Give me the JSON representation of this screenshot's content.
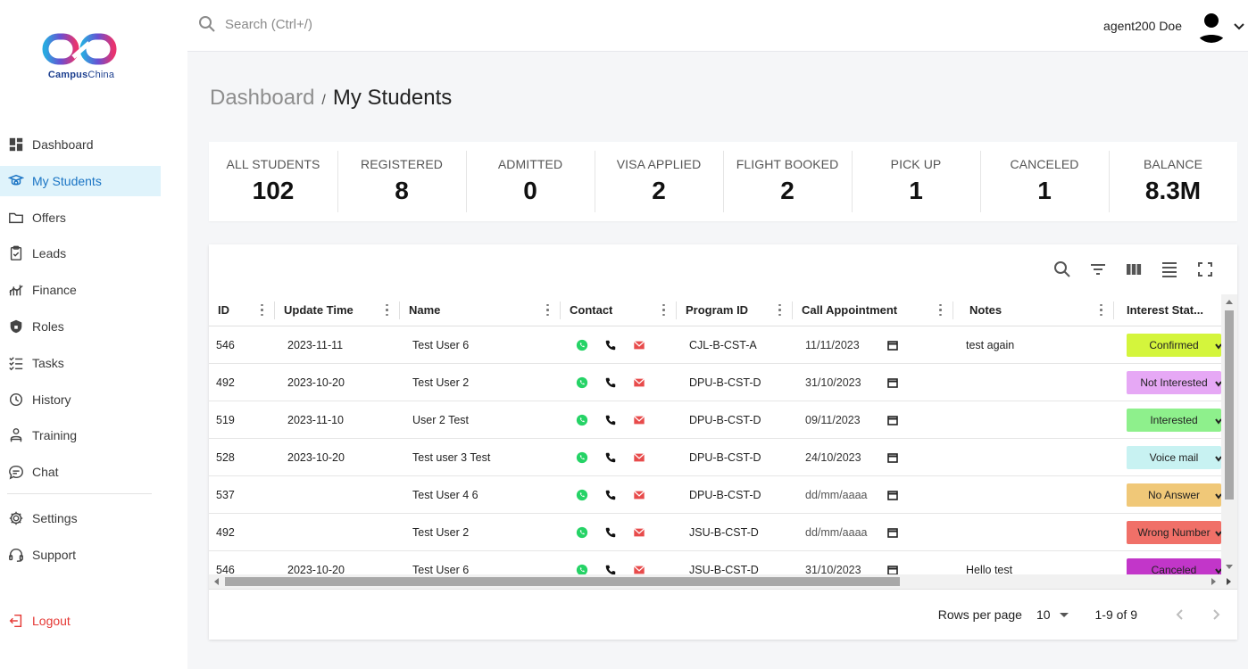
{
  "brand": {
    "name_bold": "Campus",
    "name_light": "China"
  },
  "sidebar": {
    "items": [
      {
        "label": "Dashboard",
        "icon": "dashboard-icon",
        "active": false
      },
      {
        "label": "My Students",
        "icon": "student-icon",
        "active": true
      },
      {
        "label": "Offers",
        "icon": "folder-icon",
        "active": false
      },
      {
        "label": "Leads",
        "icon": "clipboard-icon",
        "active": false
      },
      {
        "label": "Finance",
        "icon": "chart-icon",
        "active": false
      },
      {
        "label": "Roles",
        "icon": "shield-icon",
        "active": false
      },
      {
        "label": "Tasks",
        "icon": "checklist-icon",
        "active": false
      },
      {
        "label": "History",
        "icon": "history-icon",
        "active": false
      },
      {
        "label": "Training",
        "icon": "training-icon",
        "active": false
      },
      {
        "label": "Chat",
        "icon": "chat-icon",
        "active": false
      }
    ],
    "bottom_items": [
      {
        "label": "Settings",
        "icon": "gear-icon"
      },
      {
        "label": "Support",
        "icon": "headset-icon"
      }
    ],
    "logout_label": "Logout"
  },
  "topbar": {
    "search_placeholder": "Search (Ctrl+/)",
    "user_name": "agent200 Doe"
  },
  "breadcrumb": {
    "parent": "Dashboard",
    "separator": "/",
    "current": "My Students"
  },
  "stats": [
    {
      "label": "ALL STUDENTS",
      "value": "102"
    },
    {
      "label": "REGISTERED",
      "value": "8"
    },
    {
      "label": "ADMITTED",
      "value": "0"
    },
    {
      "label": "VISA APPLIED",
      "value": "2"
    },
    {
      "label": "FLIGHT BOOKED",
      "value": "2"
    },
    {
      "label": "PICK UP",
      "value": "1"
    },
    {
      "label": "CANCELED",
      "value": "1"
    },
    {
      "label": "BALANCE",
      "value": "8.3M"
    }
  ],
  "table": {
    "columns": [
      "ID",
      "Update Time",
      "Name",
      "Contact",
      "Program ID",
      "Call Appointment",
      "Notes",
      "Interest Stat..."
    ],
    "rows": [
      {
        "id": "546",
        "update": "2023-11-11",
        "name": "Test User 6",
        "program": "CJL-B-CST-A",
        "appointment": "11/11/2023",
        "placeholder": false,
        "notes": "test again",
        "status": "Confirmed",
        "status_color": "#d4f53c"
      },
      {
        "id": "492",
        "update": "2023-10-20",
        "name": "Test User 2",
        "program": "DPU-B-CST-D",
        "appointment": "31/10/2023",
        "placeholder": false,
        "notes": "",
        "status": "Not Interested",
        "status_color": "#e6a8f5"
      },
      {
        "id": "519",
        "update": "2023-11-10",
        "name": "User 2 Test",
        "program": "DPU-B-CST-D",
        "appointment": "09/11/2023",
        "placeholder": false,
        "notes": "",
        "status": "Interested",
        "status_color": "#8ef08c"
      },
      {
        "id": "528",
        "update": "2023-10-20",
        "name": "Test user 3 Test",
        "program": "DPU-B-CST-D",
        "appointment": "24/10/2023",
        "placeholder": false,
        "notes": "",
        "status": "Voice mail",
        "status_color": "#c8f2f2"
      },
      {
        "id": "537",
        "update": "",
        "name": "Test User 4 6",
        "program": "DPU-B-CST-D",
        "appointment": "dd/mm/aaaa",
        "placeholder": true,
        "notes": "",
        "status": "No Answer",
        "status_color": "#f0c878"
      },
      {
        "id": "492",
        "update": "",
        "name": "Test User 2",
        "program": "JSU-B-CST-D",
        "appointment": "dd/mm/aaaa",
        "placeholder": true,
        "notes": "",
        "status": "Wrong Number",
        "status_color": "#f07068"
      },
      {
        "id": "546",
        "update": "2023-10-20",
        "name": "Test User 6",
        "program": "JSU-B-CST-D",
        "appointment": "31/10/2023",
        "placeholder": false,
        "notes": "Hello test",
        "status": "Canceled",
        "status_color": "#c236c9"
      }
    ]
  },
  "pagination": {
    "rows_per_page_label": "Rows per page",
    "rows_per_page": "10",
    "range": "1-9 of 9"
  },
  "colors": {
    "accent": "#1a74c4",
    "active_bg": "#dff3fb",
    "logout": "#e53935",
    "whatsapp": "#25d366",
    "mail": "#e84b4b"
  }
}
